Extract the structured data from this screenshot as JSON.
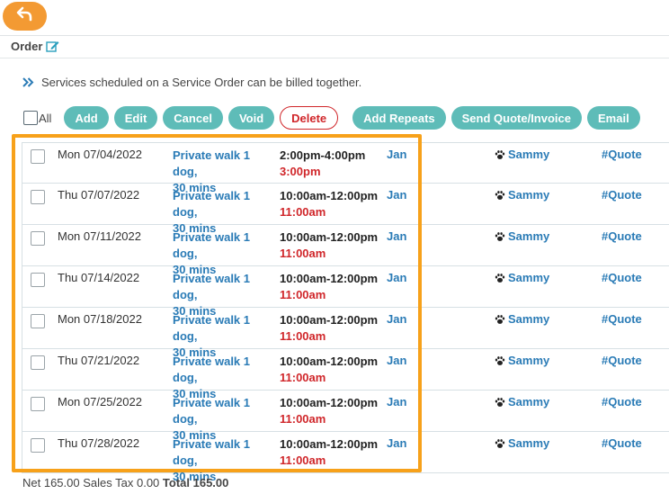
{
  "header": {
    "title": "Order"
  },
  "info": {
    "text": "Services scheduled on a Service Order can be billed together."
  },
  "toolbar": {
    "all_label": "All",
    "buttons": [
      "Add",
      "Edit",
      "Cancel",
      "Void",
      "Delete",
      "Add Repeats",
      "Send Quote/Invoice",
      "Email"
    ]
  },
  "rows": [
    {
      "date": "Mon 07/04/2022",
      "service_line1": "Private walk 1 dog,",
      "service_line2": "30 mins",
      "time": "2:00pm-4:00pm",
      "late": "3:00pm",
      "staff": "Jan",
      "pet": "Sammy",
      "quote": "#Quote"
    },
    {
      "date": "Thu 07/07/2022",
      "service_line1": "Private walk 1 dog,",
      "service_line2": "30 mins",
      "time": "10:00am-12:00pm",
      "late": "11:00am",
      "staff": "Jan",
      "pet": "Sammy",
      "quote": "#Quote"
    },
    {
      "date": "Mon 07/11/2022",
      "service_line1": "Private walk 1 dog,",
      "service_line2": "30 mins",
      "time": "10:00am-12:00pm",
      "late": "11:00am",
      "staff": "Jan",
      "pet": "Sammy",
      "quote": "#Quote"
    },
    {
      "date": "Thu 07/14/2022",
      "service_line1": "Private walk 1 dog,",
      "service_line2": "30 mins",
      "time": "10:00am-12:00pm",
      "late": "11:00am",
      "staff": "Jan",
      "pet": "Sammy",
      "quote": "#Quote"
    },
    {
      "date": "Mon 07/18/2022",
      "service_line1": "Private walk 1 dog,",
      "service_line2": "30 mins",
      "time": "10:00am-12:00pm",
      "late": "11:00am",
      "staff": "Jan",
      "pet": "Sammy",
      "quote": "#Quote"
    },
    {
      "date": "Thu 07/21/2022",
      "service_line1": "Private walk 1 dog,",
      "service_line2": "30 mins",
      "time": "10:00am-12:00pm",
      "late": "11:00am",
      "staff": "Jan",
      "pet": "Sammy",
      "quote": "#Quote"
    },
    {
      "date": "Mon 07/25/2022",
      "service_line1": "Private walk 1 dog,",
      "service_line2": "30 mins",
      "time": "10:00am-12:00pm",
      "late": "11:00am",
      "staff": "Jan",
      "pet": "Sammy",
      "quote": "#Quote"
    },
    {
      "date": "Thu 07/28/2022",
      "service_line1": "Private walk 1 dog,",
      "service_line2": "30 mins",
      "time": "10:00am-12:00pm",
      "late": "11:00am",
      "staff": "Jan",
      "pet": "Sammy",
      "quote": "#Quote"
    }
  ],
  "totals": {
    "net": "Net 165.00",
    "tax": "Sales Tax 0.00",
    "total": "Total 165.00"
  },
  "colors": {
    "accent": "#f39a33",
    "button": "#5ebcb8",
    "link": "#2a7bb6",
    "alert": "#d0262a",
    "highlight": "#f7a11a"
  },
  "icons": {
    "back": "undo-arrow-icon",
    "edit": "edit-pencil-icon",
    "info": "double-chevron-right-icon",
    "pet": "paw-icon"
  }
}
